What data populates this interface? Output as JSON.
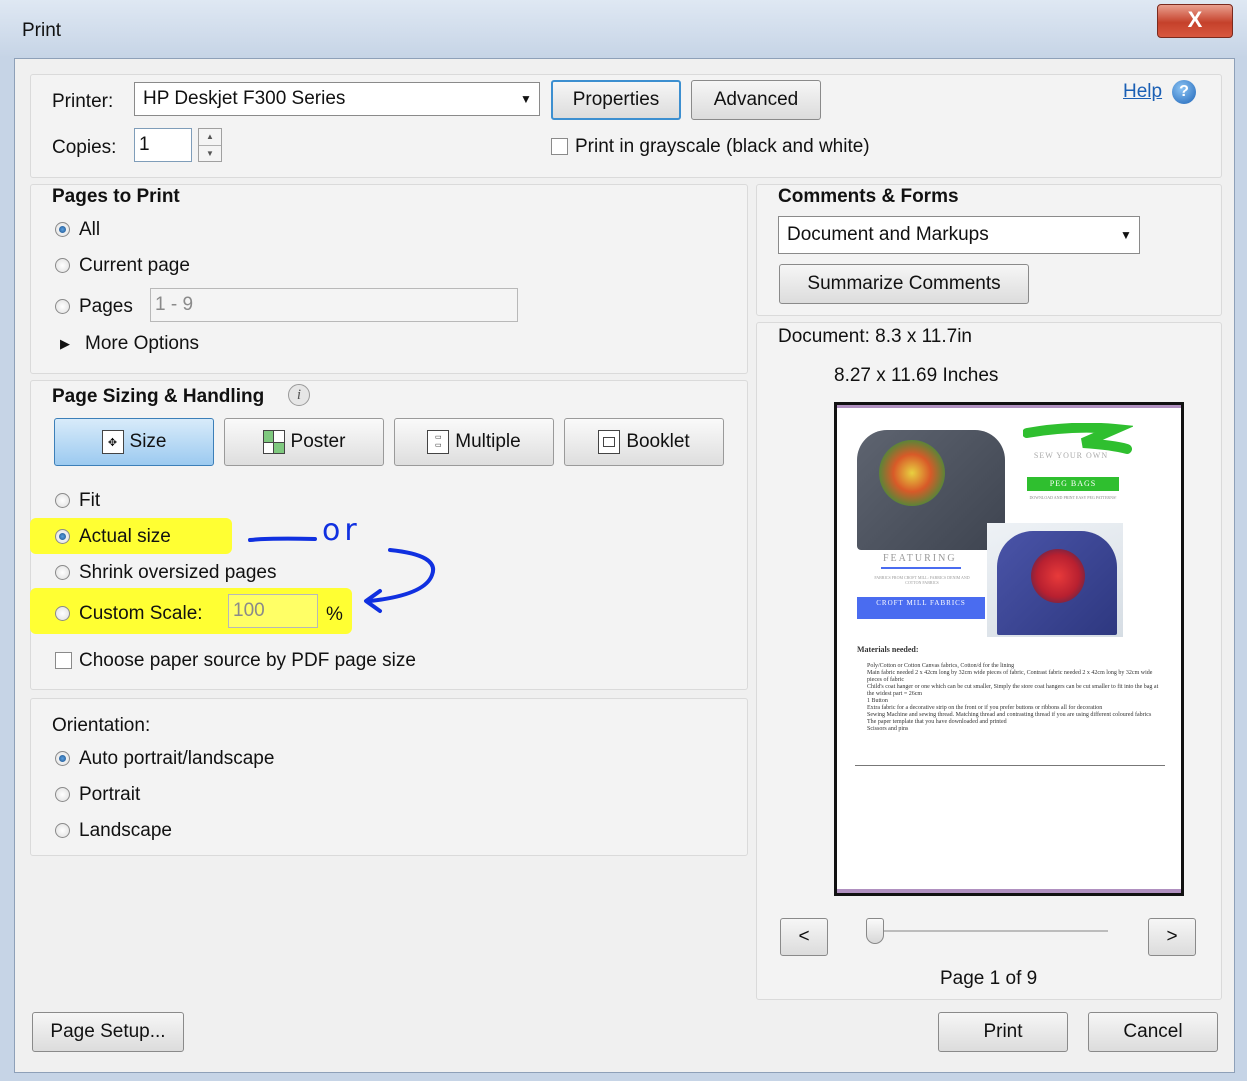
{
  "window": {
    "title": "Print",
    "close_glyph": "X"
  },
  "printer": {
    "label": "Printer:",
    "selected": "HP Deskjet F300 Series",
    "properties_label": "Properties",
    "advanced_label": "Advanced",
    "help_label": "Help",
    "copies_label": "Copies:",
    "copies_value": "1",
    "grayscale_label": "Print in grayscale (black and white)"
  },
  "pages_to_print": {
    "title": "Pages to Print",
    "all_label": "All",
    "current_label": "Current page",
    "pages_label": "Pages",
    "pages_value": "1 - 9",
    "more_options_label": "More Options"
  },
  "page_sizing": {
    "title": "Page Sizing & Handling",
    "tabs": {
      "size": "Size",
      "poster": "Poster",
      "multiple": "Multiple",
      "booklet": "Booklet"
    },
    "fit_label": "Fit",
    "actual_label": "Actual size",
    "shrink_label": "Shrink oversized pages",
    "custom_label": "Custom Scale:",
    "custom_value": "100",
    "percent": "%",
    "paper_source_label": "Choose paper source by PDF page size",
    "annotation_text": "or"
  },
  "orientation": {
    "title": "Orientation:",
    "auto_label": "Auto portrait/landscape",
    "portrait_label": "Portrait",
    "landscape_label": "Landscape"
  },
  "comments_forms": {
    "title": "Comments & Forms",
    "selected": "Document and Markups",
    "summarize_label": "Summarize Comments"
  },
  "preview": {
    "document_size": "Document: 8.3 x 11.7in",
    "paper_size": "8.27 x 11.69 Inches",
    "prev_label": "<",
    "next_label": ">",
    "page_indicator": "Page 1 of 9",
    "page": {
      "sew_your_own": "SEW YOUR OWN",
      "peg_bags": "PEG BAGS",
      "download_text": "DOWNLOAD AND PRINT EASY PEG PATTERNS!",
      "featuring": "FEATURING",
      "featuring_sub": "FABRICS FROM CROFT MILL: FABRICS DENIM AND COTTON FABRICS",
      "croft_mill": "CROFT MILL FABRICS",
      "materials_title": "Materials needed:",
      "materials": [
        "Poly/Cotton or Cotton Canvas fabrics, Cotton/d for the lining",
        "Main fabric needed 2 x 42cm long by 32cm wide pieces of fabric, Contrast fabric needed 2 x 42cm long by 32cm wide pieces of fabric",
        "Child's coat hanger or one which can be cut smaller, Simply the store coat hangers can be cut smaller to fit into the bag at the widest part = 26cm",
        "1 Button",
        "Extra fabric for a decorative strip on the front or if you prefer buttons or ribbons all for decoration",
        "Sewing Machine and sewing thread. Matching thread and contrasting thread if you are using different coloured fabrics",
        "The paper template that you have downloaded and printed",
        "Scissors and pins"
      ]
    }
  },
  "footer": {
    "page_setup_label": "Page Setup...",
    "print_label": "Print",
    "cancel_label": "Cancel"
  },
  "colors": {
    "highlight": "#ffff33",
    "annotation_ink": "#1030e0",
    "accent_blue": "#3c8fd0"
  }
}
